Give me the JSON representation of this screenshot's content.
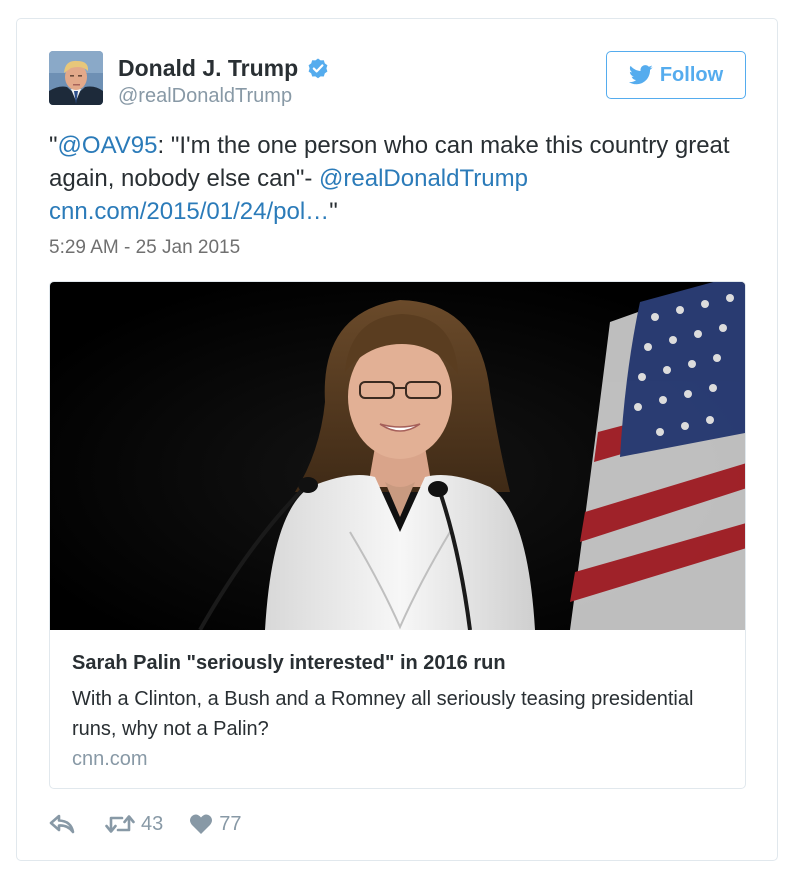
{
  "author": {
    "name": "Donald J. Trump",
    "handle": "@realDonaldTrump",
    "verified": true
  },
  "follow_button": {
    "label": "Follow"
  },
  "tweet": {
    "quote_open": "\"",
    "mention_oav": "@OAV95",
    "text_main": ": \"I'm the one person who can make this country great again, nobody else can\"- ",
    "mention_trump": "@realDonaldTrump",
    "link": "cnn.com/2015/01/24/pol…",
    "quote_close": "\"",
    "timestamp": "5:29 AM - 25 Jan 2015"
  },
  "card": {
    "title": "Sarah Palin \"seriously interested\" in 2016 run",
    "description": "With a Clinton, a Bush and a Romney all seriously teasing presidential runs, why not a Palin?",
    "domain": "cnn.com"
  },
  "actions": {
    "retweets": "43",
    "likes": "77"
  },
  "colors": {
    "accent": "#55acee",
    "link": "#2b7bb9",
    "text": "#292f33",
    "muted": "#8899a6",
    "border": "#e1e8ed"
  },
  "icons": {
    "verified": "verified-badge-icon",
    "follow": "twitter-bird-icon",
    "reply": "reply-icon",
    "retweet": "retweet-icon",
    "like": "heart-icon"
  }
}
